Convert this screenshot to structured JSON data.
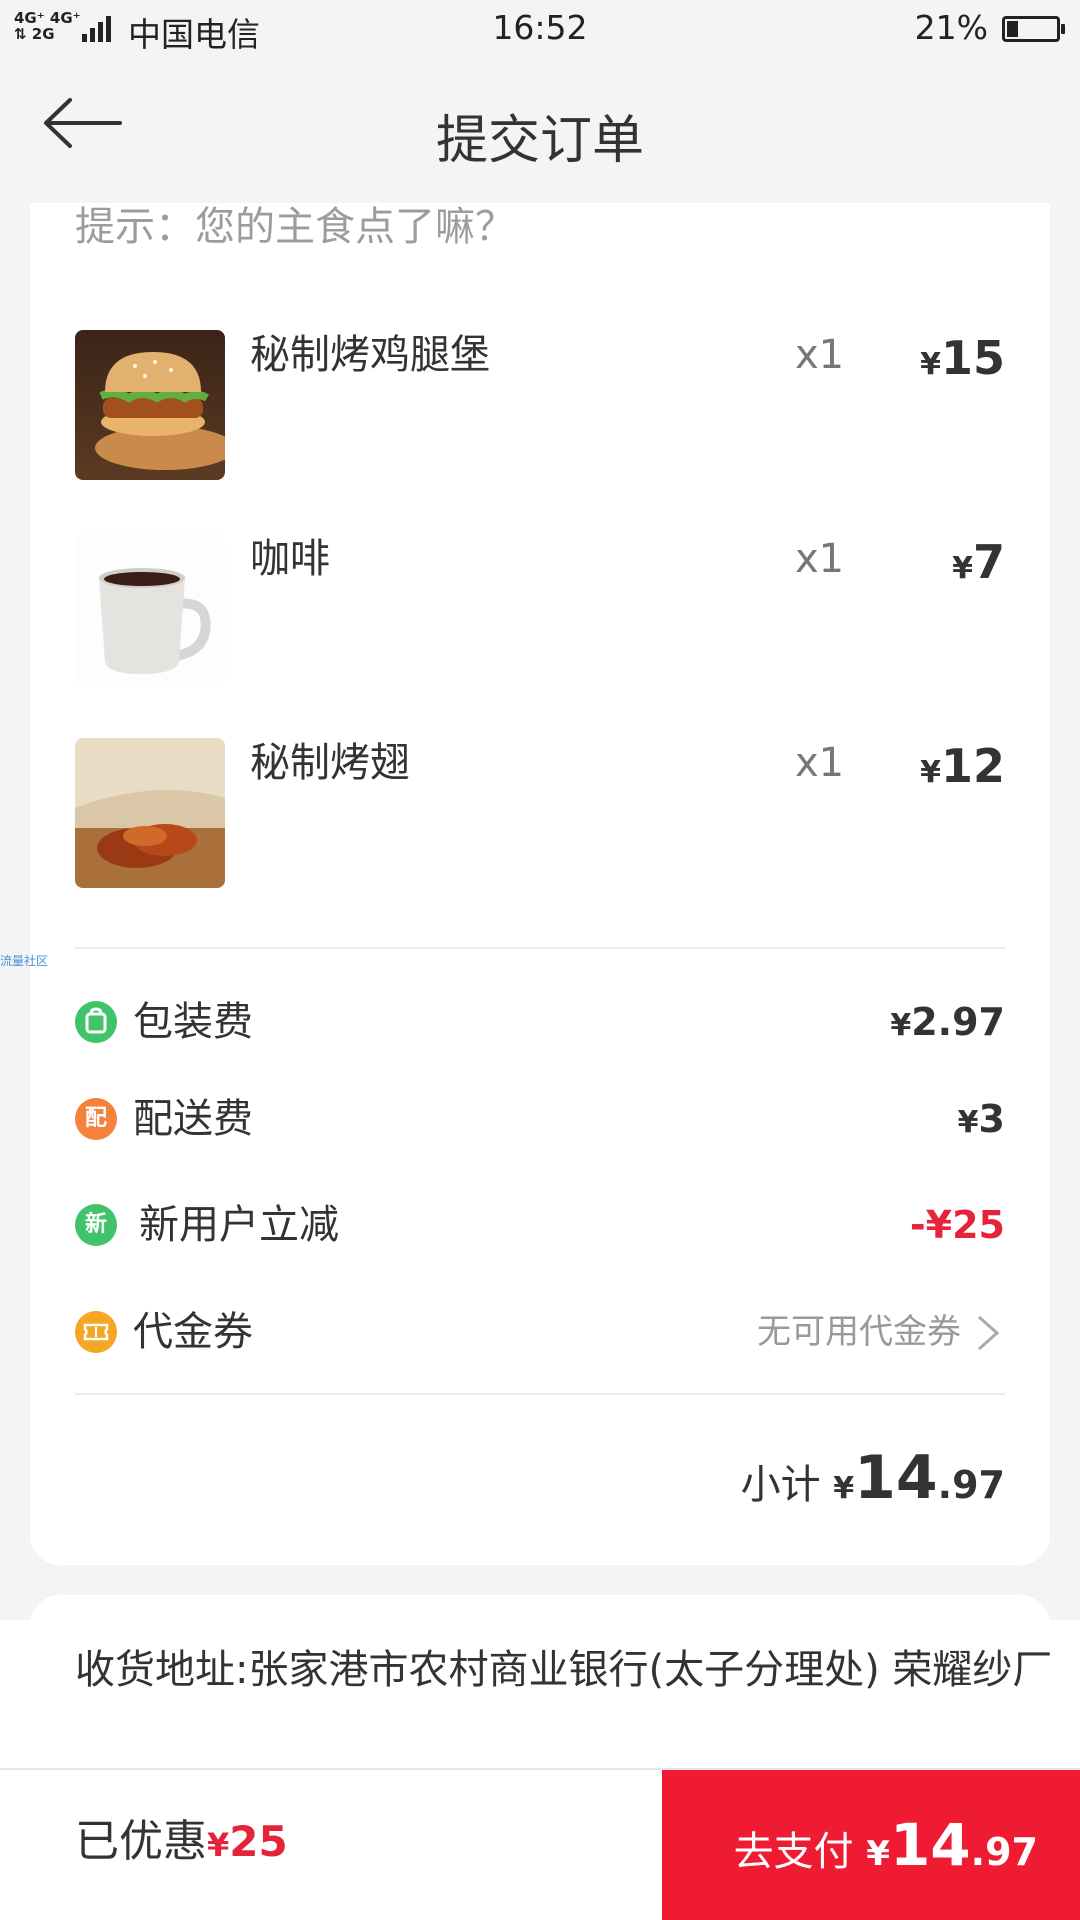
{
  "status_bar": {
    "signal_top": "4G⁺ 4G⁺",
    "signal_bottom": "⇅ 2G",
    "carrier": "中国电信",
    "time": "16:52",
    "battery": "21%"
  },
  "header": {
    "title": "提交订单"
  },
  "order": {
    "hint": "提示：您的主食点了嘛？",
    "items": [
      {
        "name": "秘制烤鸡腿堡",
        "qty": "x1",
        "currency": "¥",
        "price": "15",
        "icon": "burger-image"
      },
      {
        "name": "咖啡",
        "qty": "x1",
        "currency": "¥",
        "price": "7",
        "icon": "coffee-image"
      },
      {
        "name": "秘制烤翅",
        "qty": "x1",
        "currency": "¥",
        "price": "12",
        "icon": "wings-image"
      }
    ],
    "fees": {
      "packaging": {
        "label": "包装费",
        "currency": "¥",
        "value": "2.97",
        "icon": "bag-icon",
        "color": "#41c36a"
      },
      "delivery": {
        "label": "配送费",
        "icon_text": "配",
        "currency": "¥",
        "value": "3",
        "icon": "delivery-badge-icon",
        "color": "#f4823a"
      },
      "new_user": {
        "label": "新用户立减",
        "icon_text": "新",
        "value": "-¥25",
        "icon": "new-user-badge-icon",
        "color": "#41c36a"
      },
      "coupon": {
        "label": "代金券",
        "value": "无可用代金券",
        "icon": "coupon-icon",
        "color": "#f5a623"
      }
    },
    "subtotal": {
      "label": "小计",
      "currency": "¥",
      "int": "14",
      "dec": ".97"
    }
  },
  "address": {
    "text": "收货地址:张家港市农村商业银行(太子分理处) 荣耀纱厂"
  },
  "bottom": {
    "discount_label": "已优惠",
    "discount_currency": "¥",
    "discount_value": "25",
    "pay_label": "去支付",
    "pay_currency": "¥",
    "pay_int": "14",
    "pay_dec": ".97"
  },
  "watermark": "流量社区",
  "colors": {
    "accent": "#ef1b33",
    "discount_red": "#e5243a"
  }
}
